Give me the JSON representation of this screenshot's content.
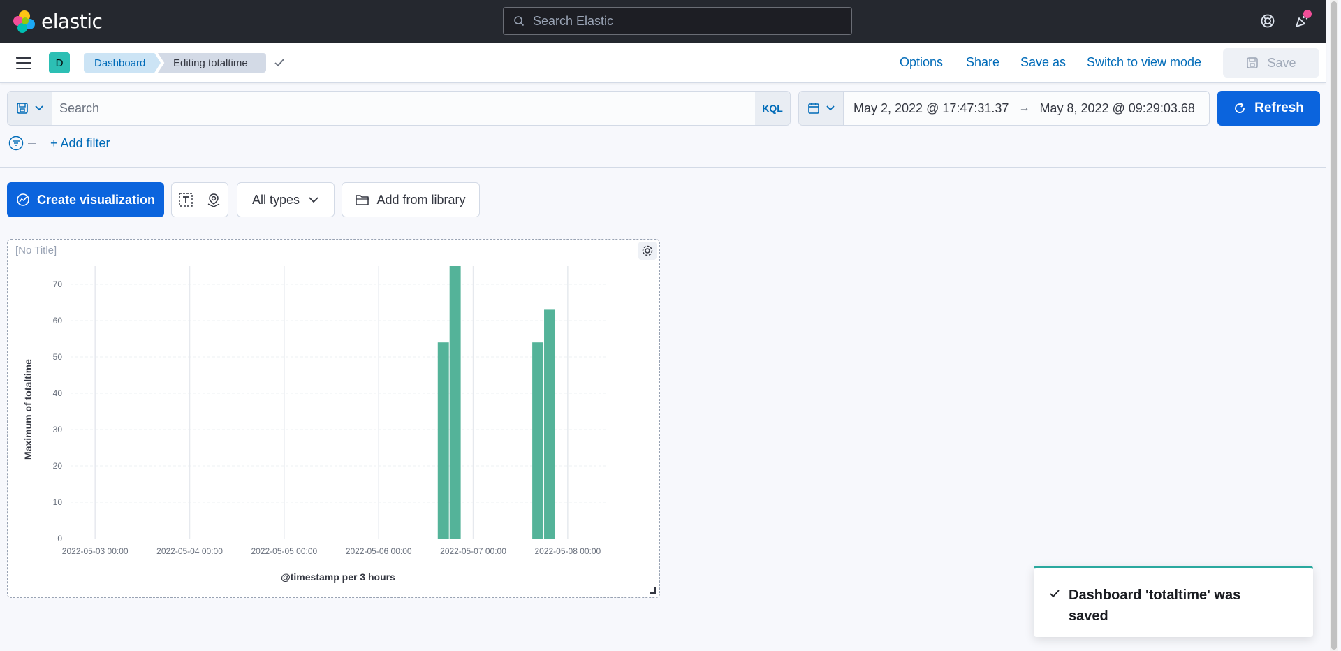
{
  "header": {
    "logo_text": "elastic",
    "search_placeholder": "Search Elastic",
    "help_icon": "help-lifebuoy-icon",
    "news_icon": "newsfeed-icon"
  },
  "app_bar": {
    "space_initial": "D",
    "breadcrumbs": [
      "Dashboard",
      "Editing totaltime"
    ],
    "links": [
      "Options",
      "Share",
      "Save as",
      "Switch to view mode"
    ],
    "save_label": "Save"
  },
  "query_bar": {
    "search_placeholder": "Search",
    "language": "KQL",
    "date_start": "May 2, 2022 @ 17:47:31.37",
    "date_end": "May 8, 2022 @ 09:29:03.68",
    "refresh_label": "Refresh"
  },
  "filters": {
    "add_filter_label": "+ Add filter"
  },
  "toolbar": {
    "create_label": "Create visualization",
    "all_types_label": "All types",
    "add_library_label": "Add from library"
  },
  "panel": {
    "title": "[No Title]"
  },
  "chart_data": {
    "type": "bar",
    "title": "",
    "xlabel": "@timestamp per 3 hours",
    "ylabel": "Maximum of totaltime",
    "ylim": [
      0,
      75
    ],
    "yticks": [
      0,
      10,
      20,
      30,
      40,
      50,
      60,
      70
    ],
    "x_tick_labels": [
      "2022-05-03 00:00",
      "2022-05-04 00:00",
      "2022-05-05 00:00",
      "2022-05-06 00:00",
      "2022-05-07 00:00",
      "2022-05-08 00:00"
    ],
    "x_range_days": [
      2.74,
      8.4
    ],
    "bar_width_hours": 3,
    "bars": [
      {
        "x": "2022-05-06 15:00",
        "start_day": 6.625,
        "value": 54
      },
      {
        "x": "2022-05-06 18:00",
        "start_day": 6.75,
        "value": 75
      },
      {
        "x": "2022-05-07 15:00",
        "start_day": 7.625,
        "value": 54
      },
      {
        "x": "2022-05-07 18:00",
        "start_day": 7.75,
        "value": 63
      }
    ],
    "bar_color": "#54b399",
    "grid": true
  },
  "toast": {
    "message": "Dashboard 'totaltime' was saved",
    "accent": "#2aa89e"
  }
}
